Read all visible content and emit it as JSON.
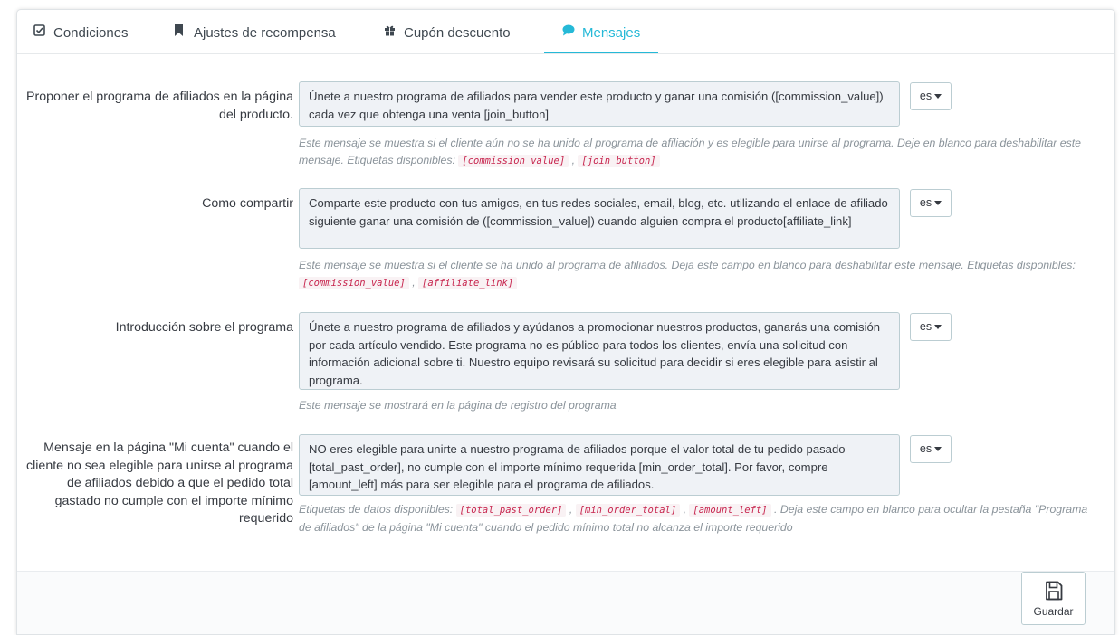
{
  "tabs": [
    {
      "label": "Condiciones",
      "icon": "checkbox-icon"
    },
    {
      "label": "Ajustes de recompensa",
      "icon": "bookmark-icon"
    },
    {
      "label": "Cupón descuento",
      "icon": "gift-icon"
    },
    {
      "label": "Mensajes",
      "icon": "comment-icon",
      "active": true
    }
  ],
  "rows": [
    {
      "label": "Proponer el programa de afiliados en la página del producto.",
      "value": "Únete a nuestro programa de afiliados para vender este producto y ganar una comisión ([commission_value]) cada vez que obtenga una venta [join_button]",
      "lang": "es",
      "help_before": "Este mensaje se muestra si el cliente aún no se ha unido al programa de afiliación y es elegible para unirse al programa. Deje en blanco para deshabilitar este mensaje. Etiquetas disponibles: ",
      "tags": [
        "[commission_value]",
        "[join_button]"
      ],
      "help_after": ""
    },
    {
      "label": "Como compartir",
      "value": "Comparte este producto con tus amigos, en tus redes sociales, email, blog, etc. utilizando el enlace de afiliado siguiente ganar una comisión de ([commission_value]) cuando alguien compra el producto[affiliate_link]",
      "lang": "es",
      "help_before": "Este mensaje se muestra si el cliente se ha unido al programa de afiliados. Deja este campo en blanco para deshabilitar este mensaje. Etiquetas disponibles: ",
      "tags": [
        "[commission_value]",
        "[affiliate_link]"
      ],
      "help_after": ""
    },
    {
      "label": "Introducción sobre el programa",
      "value": "Únete a nuestro programa de afiliados y ayúdanos a promocionar nuestros productos, ganarás una comisión por cada artículo vendido. Este programa no es público para todos los clientes, envía una solicitud con información adicional sobre ti. Nuestro equipo revisará su solicitud para decidir si eres elegible para asistir al programa.",
      "lang": "es",
      "help_before": "Este mensaje se mostrará en la página de registro del programa",
      "tags": [],
      "help_after": ""
    },
    {
      "label": "Mensaje en la página \"Mi cuenta\" cuando el cliente no sea elegible para unirse al programa de afiliados debido a que el pedido total gastado no cumple con el importe mínimo requerido",
      "value": "NO eres elegible para unirte a nuestro programa de afiliados porque el valor total de tu pedido pasado [total_past_order], no cumple con el importe mínimo requerida [min_order_total]. Por favor, compre [amount_left] más para ser elegible para el programa de afiliados.",
      "lang": "es",
      "help_before": "Etiquetas de datos disponibles: ",
      "tags": [
        "[total_past_order]",
        "[min_order_total]",
        "[amount_left]"
      ],
      "help_after": ". Deja este campo en blanco para ocultar la pestaña \"Programa de afiliados\" de la página \"Mi cuenta\" cuando el pedido mínimo total no alcanza el importe requerido"
    }
  ],
  "save": {
    "label": "Guardar",
    "icon": "save-icon"
  },
  "colors": {
    "accent": "#25b9d7",
    "tag_text": "#c7254e",
    "field_bg": "#eff2f6"
  }
}
